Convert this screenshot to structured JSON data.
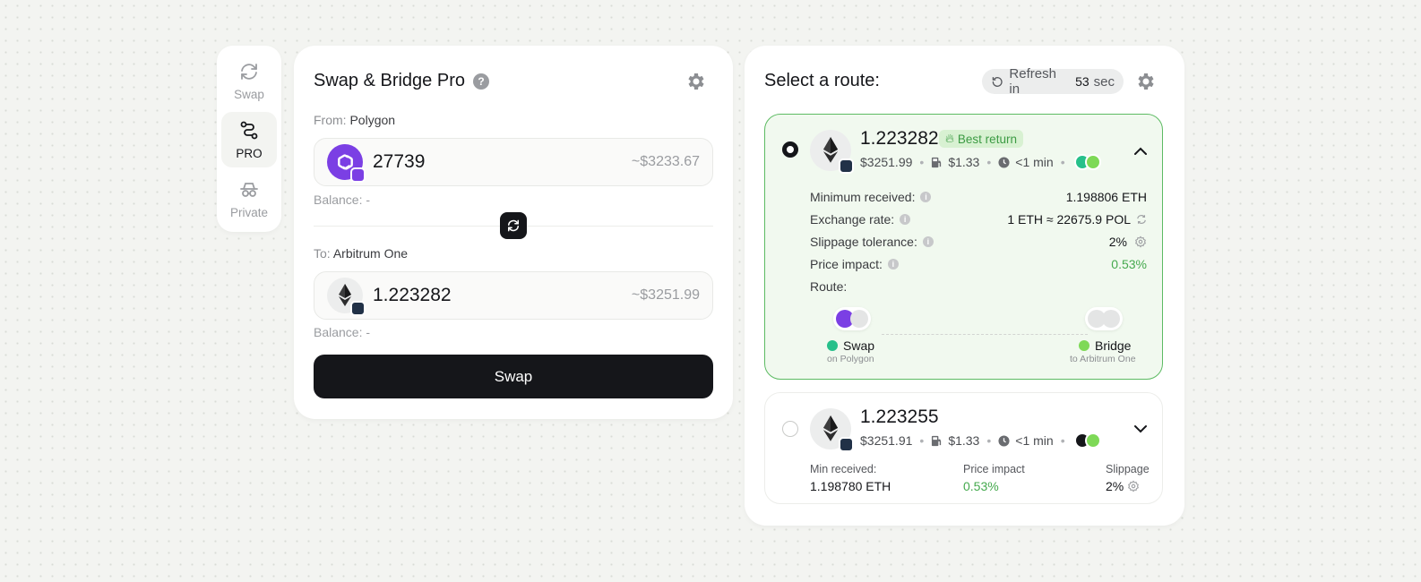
{
  "colors": {
    "accent_green": "#45a94e",
    "selected_bg": "#f1f9ef",
    "dark": "#15161a",
    "polygon_purple": "#7b3fe4",
    "arbitrum_blue": "#28a0f0"
  },
  "sidebar": {
    "items": [
      {
        "label": "Swap",
        "icon": "swap-arrows-icon",
        "active": false
      },
      {
        "label": "PRO",
        "icon": "route-nodes-icon",
        "active": true
      },
      {
        "label": "Private",
        "icon": "incognito-icon",
        "active": false
      }
    ]
  },
  "swap": {
    "title": "Swap & Bridge Pro",
    "help": "?",
    "from": {
      "label": "From:",
      "network": "Polygon",
      "amount": "27739",
      "usd": "~$3233.67",
      "balance": "Balance: -"
    },
    "to": {
      "label": "To:",
      "network": "Arbitrum One",
      "amount": "1.223282",
      "usd": "~$3251.99",
      "balance": "Balance: -"
    },
    "button": "Swap"
  },
  "routes": {
    "title": "Select a route:",
    "refresh": {
      "label": "Refresh in",
      "seconds": "53",
      "unit": "sec"
    },
    "list": [
      {
        "amount": "1.223282",
        "badge": "Best return",
        "usd": "$3251.99",
        "gas": "$1.33",
        "time": "<1 min",
        "details": {
          "min_received_label": "Minimum received:",
          "min_received": "1.198806 ETH",
          "rate_label": "Exchange rate:",
          "rate": "1 ETH ≈ 22675.9 POL",
          "slippage_label": "Slippage tolerance:",
          "slippage": "2%",
          "impact_label": "Price impact:",
          "impact": "0.53%",
          "route_label": "Route:",
          "hops": [
            {
              "name": "Swap",
              "sub": "on Polygon"
            },
            {
              "name": "Bridge",
              "sub": "to Arbitrum One"
            }
          ]
        }
      },
      {
        "amount": "1.223255",
        "usd": "$3251.91",
        "gas": "$1.33",
        "time": "<1 min",
        "summary": {
          "min_label": "Min received:",
          "min": "1.198780 ETH",
          "impact_label": "Price impact",
          "impact": "0.53%",
          "slippage_label": "Slippage",
          "slippage": "2%"
        }
      }
    ]
  }
}
